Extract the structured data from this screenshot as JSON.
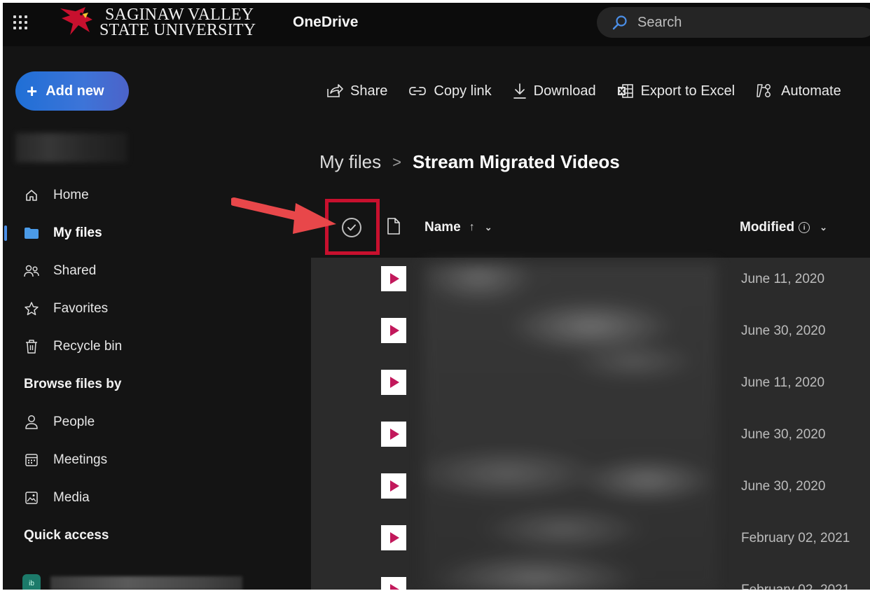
{
  "app": {
    "org_line1": "SAGINAW VALLEY",
    "org_line2": "STATE UNIVERSITY",
    "name": "OneDrive"
  },
  "search": {
    "placeholder": "Search"
  },
  "sidebar": {
    "add_new_label": "Add new",
    "nav": [
      {
        "label": "Home",
        "icon": "home-icon"
      },
      {
        "label": "My files",
        "icon": "folder-icon",
        "active": true
      },
      {
        "label": "Shared",
        "icon": "people-icon"
      },
      {
        "label": "Favorites",
        "icon": "star-icon"
      },
      {
        "label": "Recycle bin",
        "icon": "trash-icon"
      }
    ],
    "browse_heading": "Browse files by",
    "browse": [
      {
        "label": "People",
        "icon": "person-icon"
      },
      {
        "label": "Meetings",
        "icon": "calendar-icon"
      },
      {
        "label": "Media",
        "icon": "image-icon"
      }
    ],
    "quick_access_heading": "Quick access",
    "quick_access_badge": "ib"
  },
  "commands": [
    {
      "label": "Share",
      "icon": "share-icon"
    },
    {
      "label": "Copy link",
      "icon": "link-icon"
    },
    {
      "label": "Download",
      "icon": "download-icon"
    },
    {
      "label": "Export to Excel",
      "icon": "excel-icon"
    },
    {
      "label": "Automate",
      "icon": "automate-icon"
    }
  ],
  "breadcrumb": {
    "parent": "My files",
    "current": "Stream Migrated Videos"
  },
  "list": {
    "columns": {
      "name": "Name",
      "name_sort": "↑",
      "modified": "Modified"
    },
    "rows": [
      {
        "modified": "June 11, 2020"
      },
      {
        "modified": "June 30, 2020"
      },
      {
        "modified": "June 11, 2020"
      },
      {
        "modified": "June 30, 2020"
      },
      {
        "modified": "June 30, 2020"
      },
      {
        "modified": "February 02, 2021"
      },
      {
        "modified": "February 02, 2021"
      }
    ]
  },
  "colors": {
    "accent": "#3d74d8",
    "highlight": "#c8102e",
    "arrow": "#e8474a",
    "video_icon": "#c2185b"
  }
}
